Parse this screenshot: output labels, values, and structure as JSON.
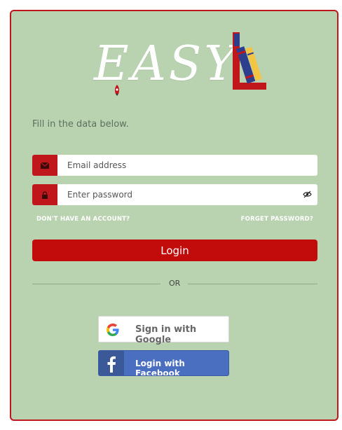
{
  "logo": {
    "text": "EASY"
  },
  "form": {
    "subtitle": "Fill in the data below.",
    "email_placeholder": "Email address",
    "password_placeholder": "Enter password",
    "no_account_label": "DON'T HAVE AN ACCOUNT?",
    "forget_password_label": "FORGET PASSWORD?",
    "login_label": "Login",
    "or_label": "OR"
  },
  "social": {
    "google_label": "Sign in with Google",
    "facebook_label": "Login with Facebook"
  },
  "colors": {
    "accent": "#c20c0c",
    "card_background": "#b9d3b0",
    "facebook": "#4a6fc0"
  }
}
